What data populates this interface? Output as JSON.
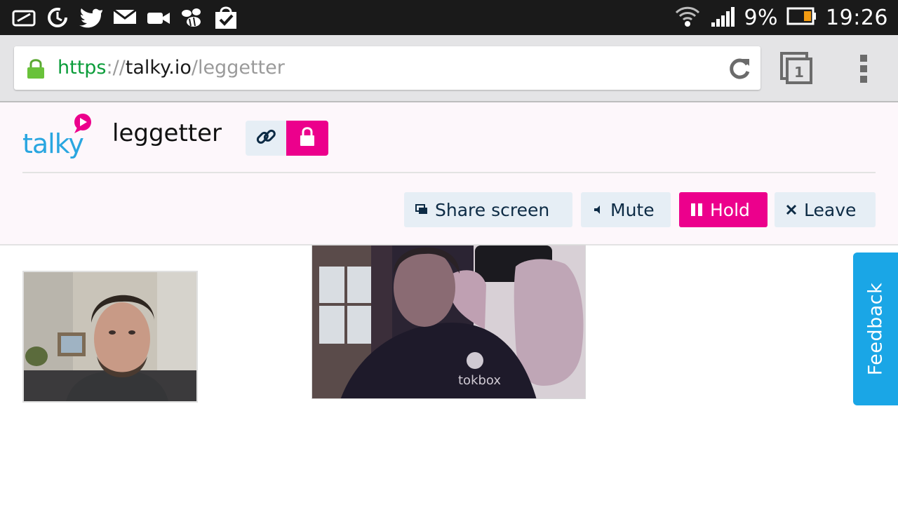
{
  "status_bar": {
    "battery": "9%",
    "time": "19:26",
    "notification_icons": [
      "sd-card-icon",
      "sync-icon",
      "twitter-icon",
      "mail-icon",
      "video-camera-icon",
      "bee-icon",
      "shopping-bag-icon"
    ],
    "signal_icons": [
      "wifi-icon",
      "cell-signal-icon",
      "battery-icon"
    ]
  },
  "browser": {
    "url_scheme": "https",
    "url_sep": "://",
    "url_host": "talky.io",
    "url_path": "/leggetter",
    "tab_count": "1"
  },
  "header": {
    "logo_text": "talky",
    "room_name": "leggetter"
  },
  "controls": {
    "share_screen": "Share screen",
    "mute": "Mute",
    "hold": "Hold",
    "leave": "Leave"
  },
  "feedback": {
    "label": "Feedback"
  },
  "colors": {
    "accent_pink": "#ec008c",
    "button_bg": "#e6eef5",
    "feedback_blue": "#1aa6e6",
    "logo_blue": "#29a6e0"
  }
}
